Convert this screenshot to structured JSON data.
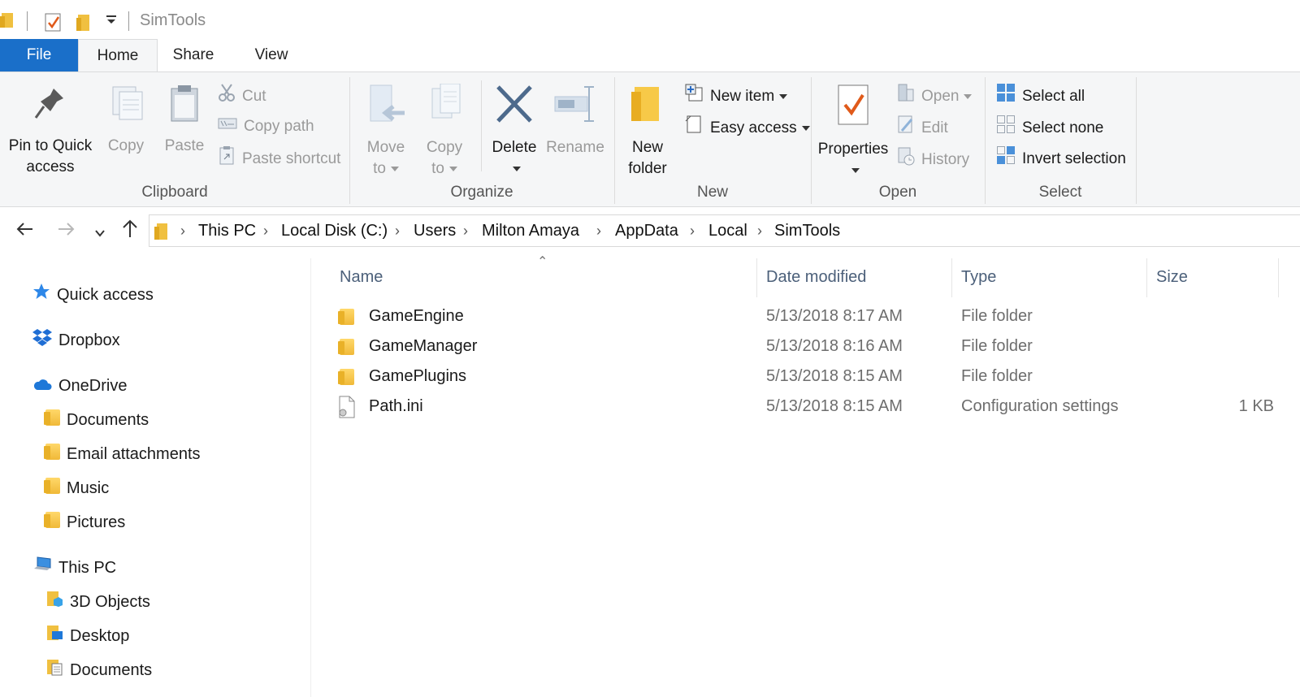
{
  "window": {
    "title": "SimTools"
  },
  "tabs": [
    {
      "label": "File"
    },
    {
      "label": "Home"
    },
    {
      "label": "Share"
    },
    {
      "label": "View"
    }
  ],
  "ribbon": {
    "clipboard": {
      "label": "Clipboard",
      "pin": "Pin to Quick",
      "pin2": "access",
      "copy": "Copy",
      "paste": "Paste",
      "cut": "Cut",
      "copy_path": "Copy path",
      "paste_shortcut": "Paste shortcut"
    },
    "organize": {
      "label": "Organize",
      "move": "Move",
      "move2": "to",
      "copy": "Copy",
      "copy2": "to",
      "delete": "Delete",
      "rename": "Rename"
    },
    "new": {
      "label": "New",
      "new_folder": "New",
      "new_folder2": "folder",
      "new_item": "New item",
      "easy_access": "Easy access"
    },
    "open": {
      "label": "Open",
      "properties": "Properties",
      "open": "Open",
      "edit": "Edit",
      "history": "History"
    },
    "select": {
      "label": "Select",
      "select_all": "Select all",
      "select_none": "Select none",
      "invert": "Invert selection"
    }
  },
  "breadcrumb": [
    "This PC",
    "Local Disk (C:)",
    "Users",
    "Milton Amaya",
    "AppData",
    "Local",
    "SimTools"
  ],
  "nav": {
    "quick_access": "Quick access",
    "dropbox": "Dropbox",
    "onedrive": "OneDrive",
    "onedrive_items": [
      "Documents",
      "Email attachments",
      "Music",
      "Pictures"
    ],
    "this_pc": "This PC",
    "this_pc_items": [
      "3D Objects",
      "Desktop",
      "Documents"
    ]
  },
  "columns": {
    "name": "Name",
    "date": "Date modified",
    "type": "Type",
    "size": "Size"
  },
  "files": [
    {
      "name": "GameEngine",
      "date": "5/13/2018 8:17 AM",
      "type": "File folder",
      "size": ""
    },
    {
      "name": "GameManager",
      "date": "5/13/2018 8:16 AM",
      "type": "File folder",
      "size": ""
    },
    {
      "name": "GamePlugins",
      "date": "5/13/2018 8:15 AM",
      "type": "File folder",
      "size": ""
    },
    {
      "name": "Path.ini",
      "date": "5/13/2018 8:15 AM",
      "type": "Configuration settings",
      "size": "1 KB"
    }
  ],
  "colors": {
    "accent": "#1a6fc9",
    "ribbon_bg": "#f5f6f7",
    "folder": "#f0b938"
  }
}
